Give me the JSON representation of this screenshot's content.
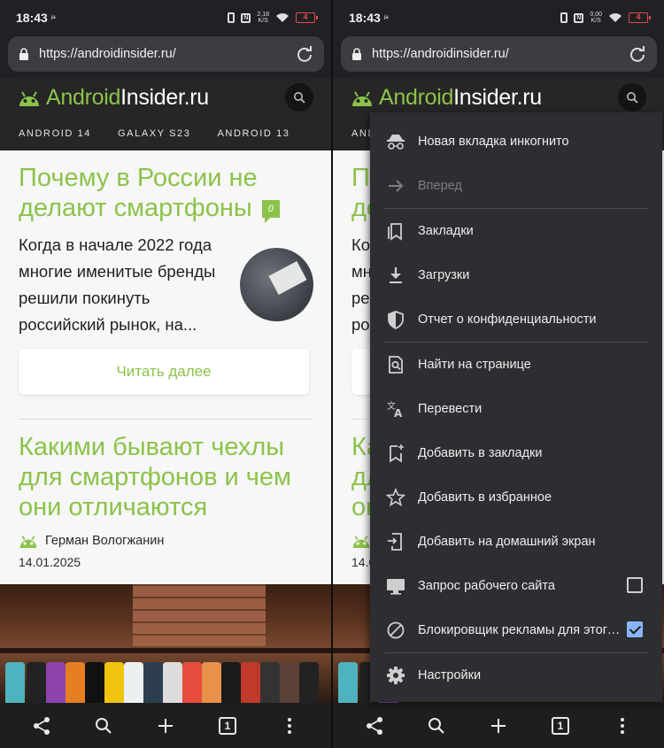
{
  "status_bar": {
    "time": "18:43",
    "carrier_badge": "ʲᵃ",
    "battery": "4"
  },
  "left": {
    "speed_value": "2,18",
    "speed_unit": "K/S"
  },
  "right": {
    "speed_value": "0,00",
    "speed_unit": "K/S"
  },
  "browser": {
    "url": "https://androidinsider.ru/",
    "tab_count": "1"
  },
  "site": {
    "logo_green": "Android",
    "logo_white": "Insider.ru",
    "tags": [
      "ANDROID 14",
      "GALAXY S23",
      "ANDROID 13"
    ]
  },
  "article1": {
    "title": "Почему в России не делают смартфоны",
    "comments": "0",
    "excerpt": "Когда в начале 2022 года многие именитые бренды решили покинуть российский рынок, на...",
    "read_more": "Читать далее"
  },
  "article2": {
    "title": "Какими бывают чехлы для смартфонов и чем они отличаются",
    "author": "Герман Вологжанин",
    "date": "14.01.2025"
  },
  "menu": {
    "items": [
      {
        "label": "Новая вкладка инкогнито",
        "icon": "incognito-icon"
      },
      {
        "label": "Вперед",
        "icon": "forward-arrow-icon"
      },
      {
        "label": "Закладки",
        "icon": "bookmarks-icon"
      },
      {
        "label": "Загрузки",
        "icon": "download-icon"
      },
      {
        "label": "Отчет о конфиденциальности",
        "icon": "shield-icon"
      },
      {
        "label": "Найти на странице",
        "icon": "find-in-page-icon"
      },
      {
        "label": "Перевести",
        "icon": "translate-icon"
      },
      {
        "label": "Добавить в закладки",
        "icon": "add-bookmark-icon"
      },
      {
        "label": "Добавить в избранное",
        "icon": "star-icon"
      },
      {
        "label": "Добавить на домашний экран",
        "icon": "add-to-home-icon"
      },
      {
        "label": "Запрос рабочего сайта",
        "icon": "desktop-icon",
        "checked": false
      },
      {
        "label": "Блокировщик рекламы для этого сайта",
        "icon": "block-icon",
        "checked": true
      },
      {
        "label": "Настройки",
        "icon": "gear-icon"
      }
    ]
  },
  "colors": {
    "accent": "#8bc34a",
    "menu_bg": "#2d2e31",
    "checkbox_on": "#8ab4f8"
  }
}
